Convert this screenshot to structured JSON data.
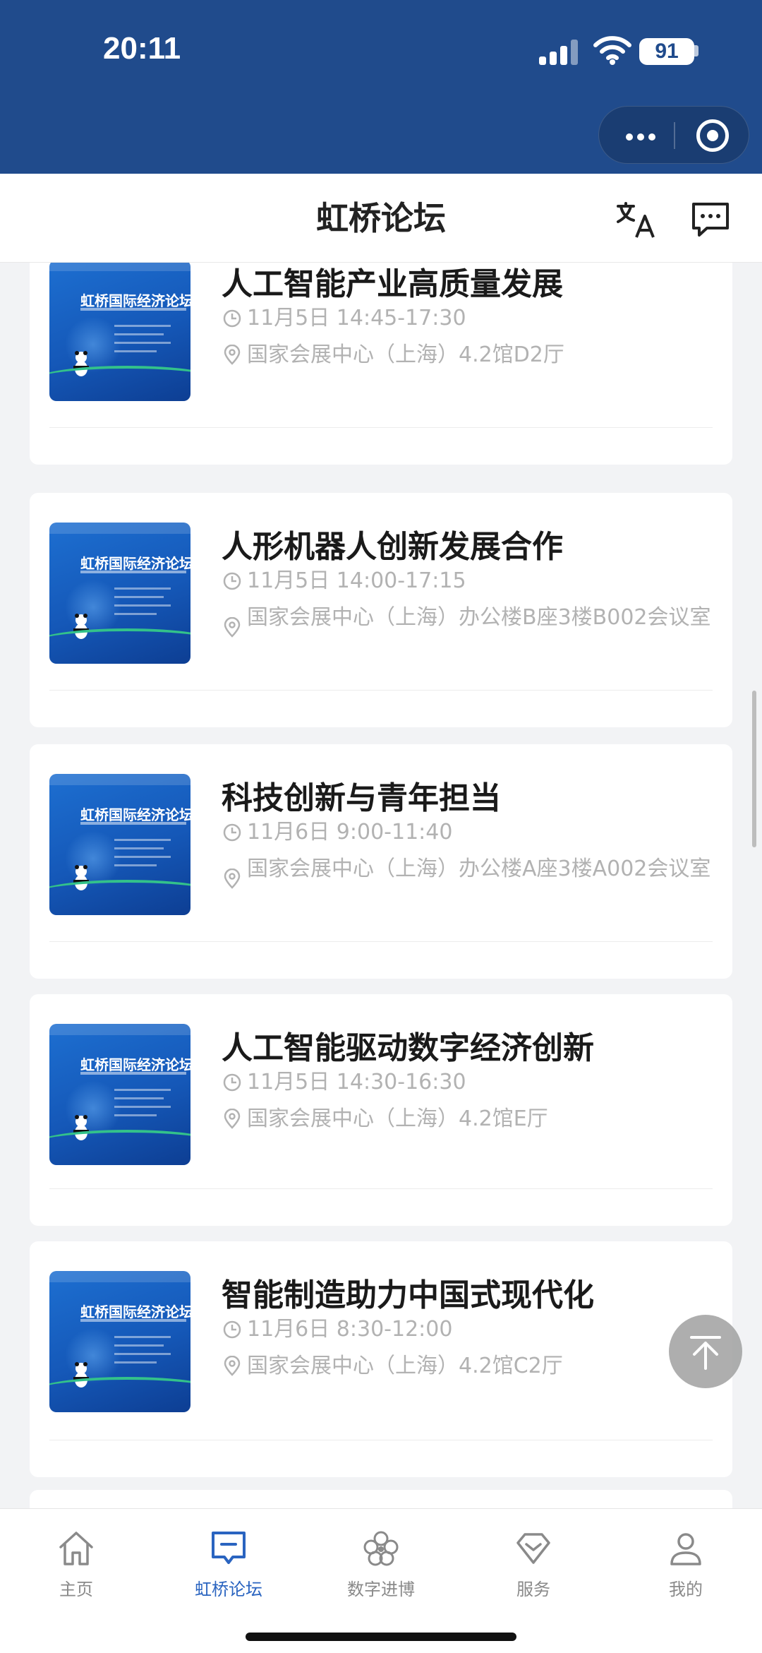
{
  "status_bar": {
    "time": "20:11",
    "battery": "91"
  },
  "header": {
    "title": "虹桥论坛"
  },
  "sessions": [
    {
      "title": "人工智能产业高质量发展",
      "time": "11月5日 14:45-17:30",
      "location": "国家会展中心（上海）4.2馆D2厅",
      "poster_title": "虹桥国际经济论坛会"
    },
    {
      "title": "人形机器人创新发展合作",
      "time": "11月5日 14:00-17:15",
      "location": "国家会展中心（上海）办公楼B座3楼B002会议室",
      "poster_title": "虹桥国际经济论坛会"
    },
    {
      "title": "科技创新与青年担当",
      "time": "11月6日 9:00-11:40",
      "location": "国家会展中心（上海）办公楼A座3楼A002会议室",
      "poster_title": "虹桥国际经济论坛会"
    },
    {
      "title": "人工智能驱动数字经济创新",
      "time": "11月5日 14:30-16:30",
      "location": "国家会展中心（上海）4.2馆E厅",
      "poster_title": "虹桥国际经济论坛会"
    },
    {
      "title": "智能制造助力中国式现代化",
      "time": "11月6日 8:30-12:00",
      "location": "国家会展中心（上海）4.2馆C2厅",
      "poster_title": "虹桥国际经济论坛会"
    }
  ],
  "tabs": [
    {
      "label": "主页",
      "icon": "home-icon"
    },
    {
      "label": "虹桥论坛",
      "icon": "forum-icon",
      "active": true
    },
    {
      "label": "数字进博",
      "icon": "flower-icon"
    },
    {
      "label": "服务",
      "icon": "diamond-icon"
    },
    {
      "label": "我的",
      "icon": "user-icon"
    }
  ],
  "colors": {
    "header_bg": "#204b8c",
    "accent": "#2a64c0",
    "meta_text": "#b2b2b2"
  }
}
